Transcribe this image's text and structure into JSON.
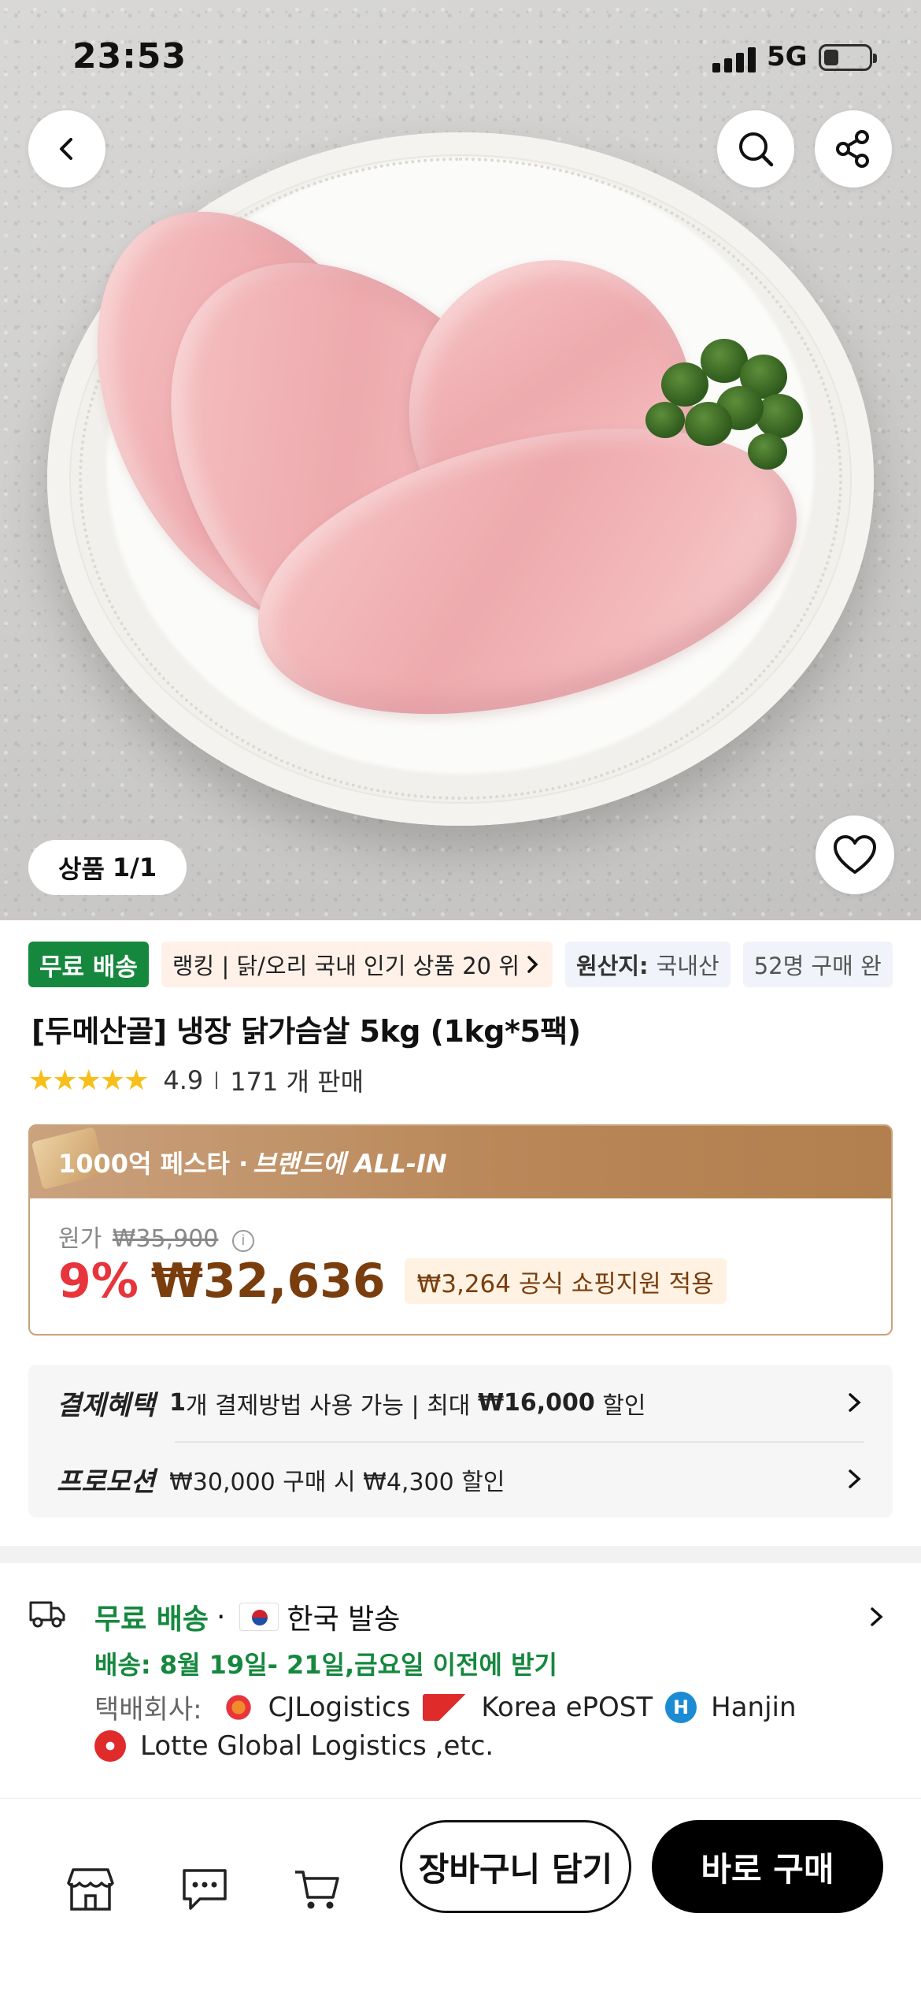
{
  "status_bar": {
    "time": "23:53",
    "network": "5G"
  },
  "hero": {
    "counter_label": "상품",
    "counter_value": "1/1"
  },
  "tags": {
    "free_shipping": "무료 배송",
    "ranking": "랭킹 | 닭/오리 국내 인기 상품 20 위",
    "origin_label": "원산지:",
    "origin_value": "국내산",
    "buyers": "52명 구매 완"
  },
  "product": {
    "title": "[두메산골] 냉장 닭가슴살 5kg (1kg*5팩)",
    "rating": "4.9",
    "sold": "171 개 판매"
  },
  "price": {
    "banner_prefix": "1000억 페스타 · ",
    "banner_brand": "브랜드에 ALL-IN",
    "original_label": "원가",
    "original_price": "₩35,900",
    "discount": "9%",
    "sale_price": "₩32,636",
    "support": "₩3,264 공식 쇼핑지원 적용"
  },
  "benefits": {
    "payment_label": "결제혜택",
    "payment_count": "1",
    "payment_text": "개 결제방법 사용 가능 | 최대 ",
    "payment_amount": "₩16,000",
    "payment_suffix": " 할인",
    "promo_label": "프로모션",
    "promo_text": "₩30,000 구매 시 ₩4,300 할인"
  },
  "shipping": {
    "free": "무료 배송",
    "dot": "·",
    "from": "한국 발송",
    "delivery": "배송: 8월 19일- 21일,금요일 이전에 받기",
    "carrier_label": "택배회사:",
    "carriers": [
      "CJLogistics",
      "Korea ePOST",
      "Hanjin",
      "Lotte Global Logistics ,etc."
    ]
  },
  "bottom_bar": {
    "add_to_cart": "장바구니 담기",
    "buy_now": "바로 구매"
  },
  "colors": {
    "green": "#15883e",
    "price_brown": "#7a3e0e",
    "discount_red": "#e8343b",
    "banner_gold": "#b98758"
  }
}
